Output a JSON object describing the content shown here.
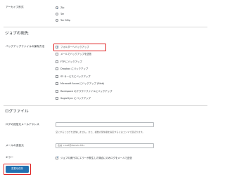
{
  "archive": {
    "label": "アーカイブ形式",
    "options": [
      {
        "label": "Zip",
        "selected": true
      },
      {
        "label": "Tar",
        "selected": false
      },
      {
        "label": "Tar GZip",
        "selected": false
      }
    ]
  },
  "destination": {
    "heading": "ジョブの宛先",
    "label": "バックアップファイルの保存方法",
    "options": [
      {
        "label": "フォルダーへバックアップ",
        "checked": true
      },
      {
        "label": "メールでバックアップを送信",
        "checked": false
      },
      {
        "label": "FTP にバックアップ",
        "checked": false
      },
      {
        "label": "Dropbox にバックアップ",
        "checked": false
      },
      {
        "label": "S3 サービスにバックアップ",
        "checked": false
      },
      {
        "label": "Microsoft Azure にバックアップ (Blob)",
        "checked": false
      },
      {
        "label": "Rackspace のクラウドファイルにバックアップ",
        "checked": false
      },
      {
        "label": "SugarSync にバックアップ",
        "checked": false
      }
    ]
  },
  "log": {
    "heading": "ログファイル",
    "email_label": "ログの送信元メールアドレス",
    "email_value": "",
    "email_desc": "空にするとログを送信しません。また、複数の受信者を指定するにはコンマで区切ります。",
    "name_label": "メールの送信元",
    "name_placeholder": "名前 <mail@domain.tld>",
    "errors_label": "エラー",
    "errors_text": "ジョブの実行中にエラーが発生した場合にのみログをメールで送信",
    "errors_checked": true
  },
  "save_button": "変更を保存",
  "colors": {
    "accent": "#2271b1",
    "highlight": "#e02424"
  }
}
